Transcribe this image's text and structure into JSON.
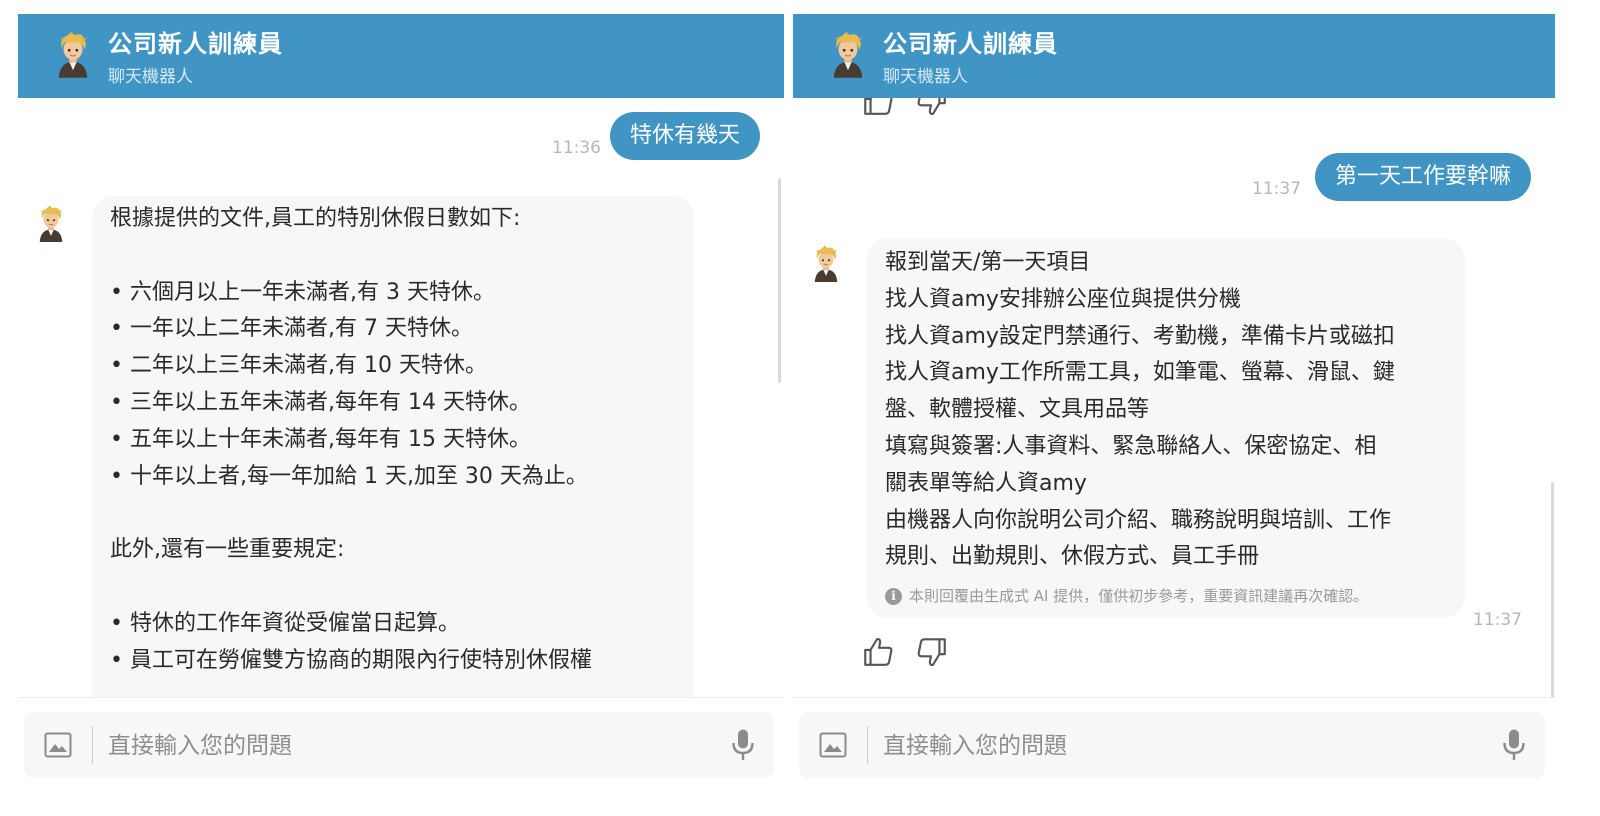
{
  "header": {
    "title": "公司新人訓練員",
    "subtitle": "聊天機器人"
  },
  "colors": {
    "accent": "#4195c5",
    "bot_bubble": "#f7f7f7",
    "timestamp": "#b7b7b7"
  },
  "icons": [
    "avatar-boy-emoji",
    "thumbs-up-icon",
    "thumbs-down-icon",
    "image-icon",
    "microphone-icon",
    "info-icon"
  ],
  "left_chat": {
    "user_message": "特休有幾天",
    "user_time": "11:36",
    "bot_lines": [
      "根據提供的文件,員工的特別休假日數如下:",
      "",
      "• 六個月以上一年未滿者,有 3 天特休。",
      "• 一年以上二年未滿者,有 7 天特休。",
      "• 二年以上三年未滿者,有 10 天特休。",
      "• 三年以上五年未滿者,每年有 14 天特休。",
      "• 五年以上十年未滿者,每年有 15 天特休。",
      "• 十年以上者,每一年加給 1 天,加至 30 天為止。",
      "",
      "此外,還有一些重要規定:",
      "",
      "• 特休的工作年資從受僱當日起算。",
      "• 員工可在勞僱雙方協商的期限內行使特別休假權"
    ]
  },
  "right_chat": {
    "user_message": "第一天工作要幹嘛",
    "user_time": "11:37",
    "bot_lines": [
      "報到當天/第一天項目",
      "找人資amy安排辦公座位與提供分機",
      "找人資amy設定門禁通行、考勤機，準備卡片或磁扣",
      "找人資amy工作所需工具，如筆電、螢幕、滑鼠、鍵",
      "盤、軟體授權、文具用品等",
      "填寫與簽署:人事資料、緊急聯絡人、保密協定、相",
      "關表單等給人資amy",
      "由機器人向你說明公司介紹、職務說明與培訓、工作",
      "規則、出勤規則、休假方式、員工手冊"
    ],
    "disclaimer": "本則回覆由生成式 AI 提供，僅供初步參考，重要資訊建議再次確認。",
    "bot_time": "11:37"
  },
  "input": {
    "placeholder": "直接輸入您的問題"
  }
}
